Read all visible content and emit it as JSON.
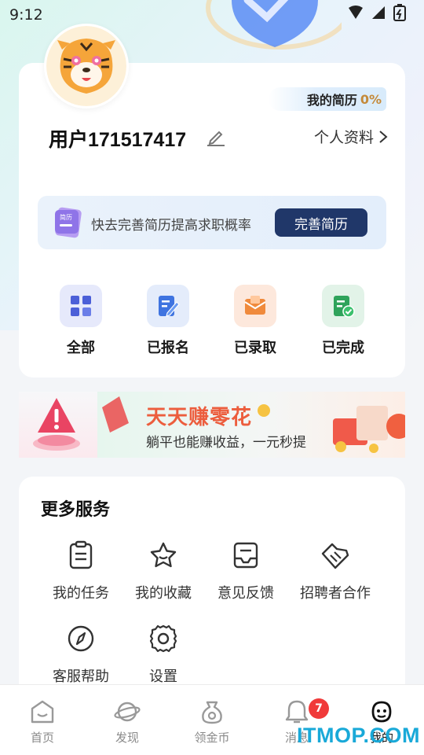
{
  "status_bar": {
    "time": "9:12"
  },
  "profile": {
    "username": "用户171517417",
    "resume_label": "我的简历",
    "resume_percent": "0%",
    "profile_link": "个人资料"
  },
  "resume_banner": {
    "text": "快去完善简历提高求职概率",
    "button": "完善简历",
    "icon_text": "简历"
  },
  "quick_actions": [
    {
      "label": "全部",
      "icon": "grid-icon"
    },
    {
      "label": "已报名",
      "icon": "edit-doc-icon"
    },
    {
      "label": "已录取",
      "icon": "envelope-icon"
    },
    {
      "label": "已完成",
      "icon": "check-doc-icon"
    }
  ],
  "promo": {
    "title": "天天赚零花",
    "subtitle": "躺平也能赚收益，一元秒提"
  },
  "services": {
    "heading": "更多服务",
    "items": [
      {
        "label": "我的任务",
        "icon": "clipboard-icon"
      },
      {
        "label": "我的收藏",
        "icon": "star-icon"
      },
      {
        "label": "意见反馈",
        "icon": "inbox-icon"
      },
      {
        "label": "招聘者合作",
        "icon": "handshake-icon"
      },
      {
        "label": "客服帮助",
        "icon": "compass-icon"
      },
      {
        "label": "设置",
        "icon": "gear-icon"
      }
    ]
  },
  "tabbar": {
    "items": [
      {
        "label": "首页",
        "icon": "home-icon"
      },
      {
        "label": "发现",
        "icon": "planet-icon"
      },
      {
        "label": "领金币",
        "icon": "coin-bag-icon"
      },
      {
        "label": "消息",
        "icon": "bell-icon"
      },
      {
        "label": "我的",
        "icon": "smile-icon"
      }
    ],
    "message_badge": "7"
  },
  "watermark": "ITMOP.COM"
}
